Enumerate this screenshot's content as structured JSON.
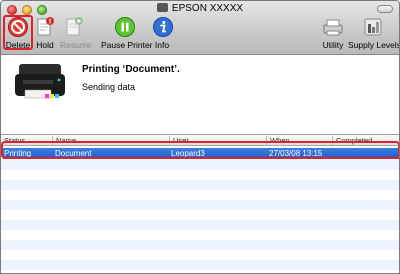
{
  "window": {
    "title": "EPSON XXXXX"
  },
  "toolbar": {
    "delete_label": "Delete",
    "hold_label": "Hold",
    "resume_label": "Resume",
    "pause_label": "Pause Printer",
    "info_label": "Info",
    "utility_label": "Utility",
    "supply_label": "Supply Levels"
  },
  "job": {
    "title": "Printing ‘Document’.",
    "status": "Sending data"
  },
  "table": {
    "columns": [
      "Status",
      "Name",
      "User",
      "When",
      "Completed"
    ],
    "rows": [
      {
        "status": "Printing",
        "name": "Document",
        "user": "Leopard3",
        "when": "27/03/08 13:15",
        "completed": ""
      }
    ]
  },
  "colors": {
    "selection": "#1c5bd0",
    "highlight_outline": "#e0202a",
    "stripe": "#edf3fe"
  },
  "icons": [
    "delete-icon",
    "hold-icon",
    "resume-icon",
    "pause-icon",
    "info-icon",
    "utility-icon",
    "supply-levels-icon",
    "printer-icon"
  ]
}
